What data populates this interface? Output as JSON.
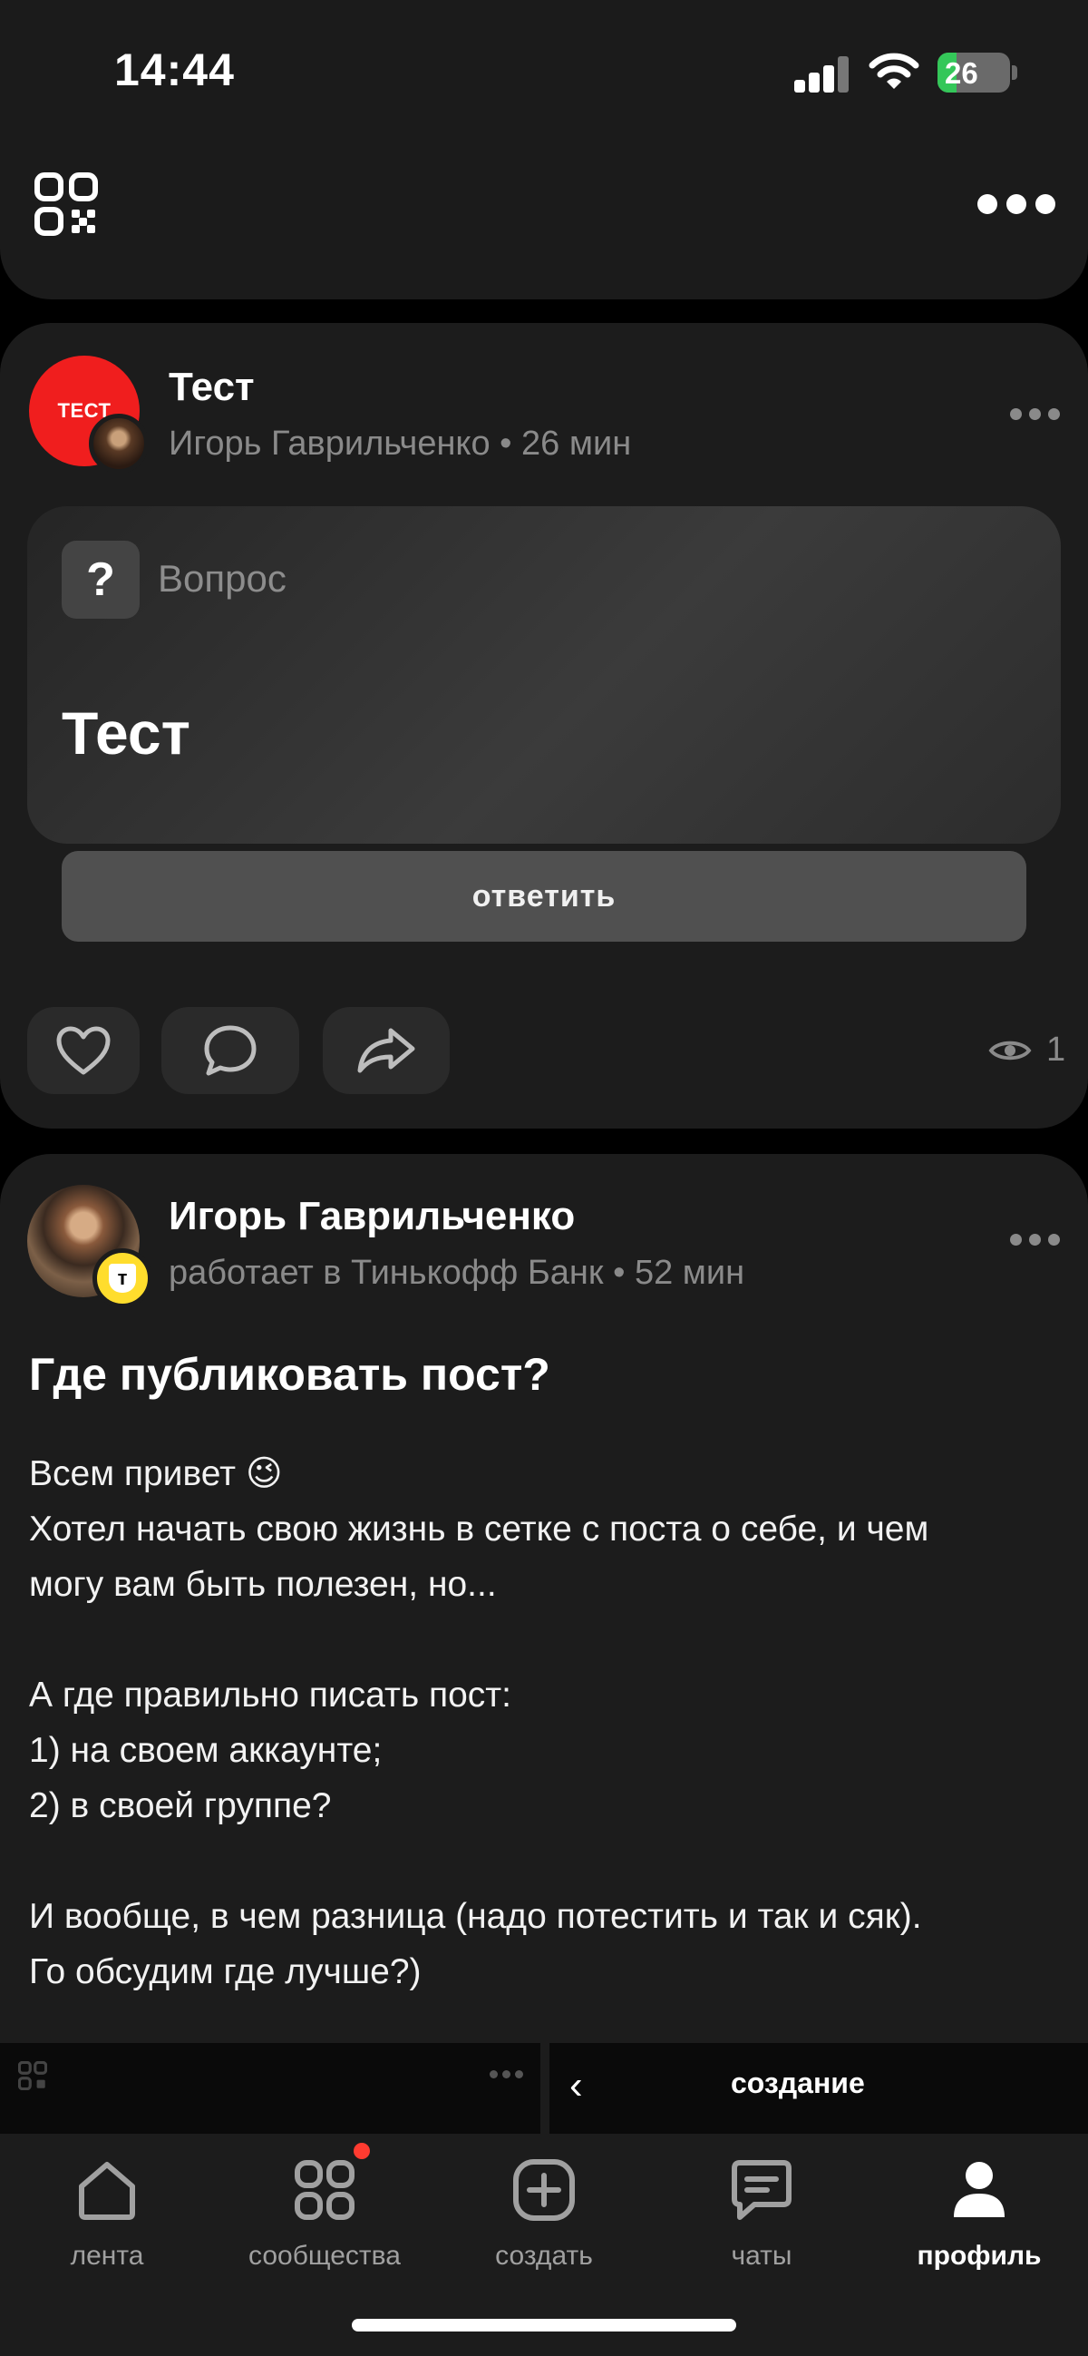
{
  "status_bar": {
    "time": "14:44",
    "battery": "26",
    "battery_fraction": 0.26
  },
  "post1": {
    "avatar_text": "ТЕСТ",
    "title": "Тест",
    "meta": "Игорь Гаврильченко • 26 мин",
    "type_label": "Вопрос",
    "question": "Тест",
    "answer_button": "ответить",
    "views": "1"
  },
  "post2": {
    "author": "Игорь Гаврильченко",
    "meta": "работает в Тинькофф Банк • 52 мин",
    "badge": "т",
    "title": "Где публиковать пост?",
    "body": [
      "Всем привет 😉",
      "Хотел начать свою жизнь в сетке с поста о себе, и чем",
      "могу вам быть полезен, но...",
      "",
      "А где правильно писать пост:",
      "1) на своем аккаунте;",
      "2) в своей группе?",
      "",
      "И вообще, в чем разница (надо потестить и так и сяк).",
      "Го обсудим где лучше?)"
    ]
  },
  "preview": {
    "right_title": "создание"
  },
  "tabbar": {
    "tabs": [
      {
        "label": "лента",
        "icon": "home-icon"
      },
      {
        "label": "сообщества",
        "icon": "grid-icon"
      },
      {
        "label": "создать",
        "icon": "plus-icon"
      },
      {
        "label": "чаты",
        "icon": "chat-icon"
      },
      {
        "label": "профиль",
        "icon": "profile-icon"
      }
    ],
    "active": "профиль"
  },
  "colors": {
    "accent_red": "#f01e1e",
    "badge_yellow": "#ffdd2d",
    "battery_green": "#34c759",
    "notification": "#ff3b30"
  }
}
